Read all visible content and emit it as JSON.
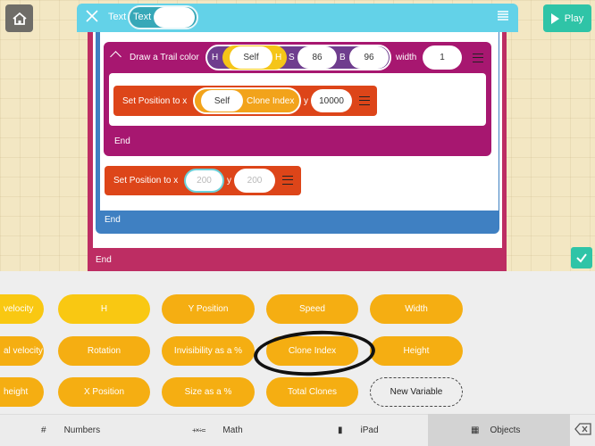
{
  "editor": {
    "header_label": "Text",
    "pill_label": "Text"
  },
  "play": {
    "label": "Play"
  },
  "trail": {
    "label": "Draw a Trail color",
    "h_letter": "H",
    "self_label": "Self",
    "h_small": "H",
    "s_letter": "S",
    "s_value": "86",
    "b_letter": "B",
    "b_value": "96",
    "width_label": "width",
    "width_value": "1",
    "end": "End"
  },
  "set_position_1": {
    "label": "Set Position to x",
    "self_label": "Self",
    "clone_label": "Clone Index",
    "y_label": "y",
    "y_value": "10000"
  },
  "set_position_2": {
    "label": "Set Position to x",
    "x_value": "200",
    "y_label": "y",
    "y_value": "200"
  },
  "blue_end": "End",
  "outer_end": "End",
  "palette": {
    "row1": [
      "velocity",
      "H",
      "Y Position",
      "Speed",
      "Width"
    ],
    "row2": [
      "al velocity",
      "Rotation",
      "Invisibility as a %",
      "Clone Index",
      "Height"
    ],
    "row3": [
      "height",
      "X Position",
      "Size as a %",
      "Total Clones",
      "New Variable"
    ]
  },
  "tabs": [
    {
      "icon": "#",
      "label": "Numbers"
    },
    {
      "icon": "+×÷=",
      "label": "Math"
    },
    {
      "icon": "▮",
      "label": "iPad"
    },
    {
      "icon": "▦",
      "label": "Objects"
    }
  ],
  "colors": {
    "header": "#63d2e8",
    "trail_block": "#a71770",
    "set_position_block": "#dd4519",
    "outer_block": "#bd2d63",
    "blue_block": "#3f80c2",
    "palette_button": "#f5ae12",
    "play_button": "#2fc4a7"
  }
}
